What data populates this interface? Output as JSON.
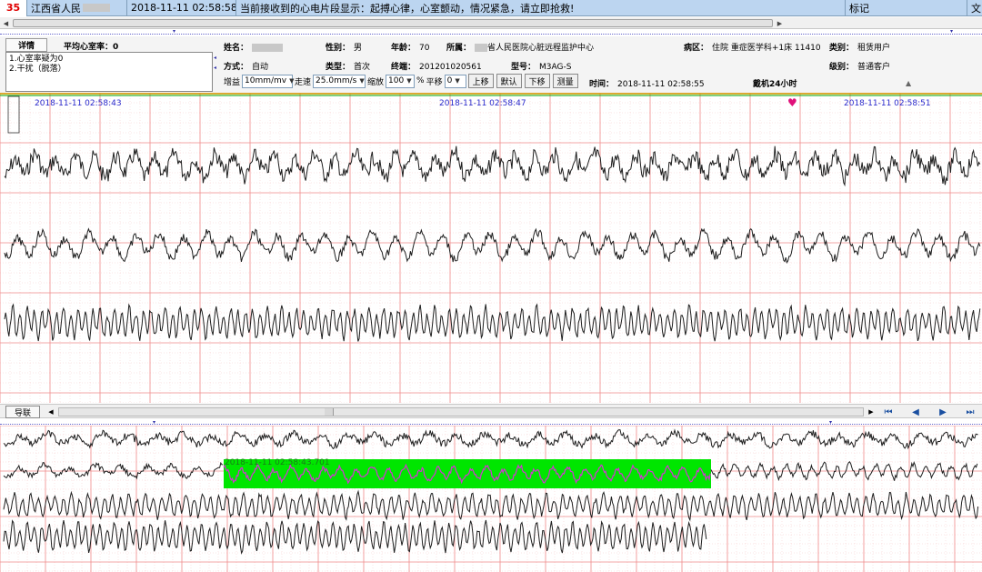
{
  "alarm": {
    "count": "35",
    "hospital": "江西省人民",
    "time": "2018-11-11 02:58:58",
    "message": "当前接收到的心电片段显示：起搏心律，心室颤动，情况紧急，请立即抢救!",
    "mark_label": "标记",
    "extra": "文"
  },
  "detail_tab": "详情",
  "avg_hr": {
    "label": "平均心室率：",
    "value": "0"
  },
  "diagnosis": [
    "1.心室率疑为0",
    "2.干扰（脱落）"
  ],
  "patient": {
    "name_label": "姓名：",
    "gender_label": "性别：",
    "gender": "男",
    "age_label": "年龄：",
    "age": "70",
    "affiliation_label": "所属：",
    "affiliation": "省人民医院心脏远程监护中心",
    "ward_label": "病区：",
    "ward": "住院 重症医学科+1床 11410",
    "category_label": "类别：",
    "category": "租赁用户",
    "mode_label": "方式：",
    "mode": "自动",
    "type_label": "类型：",
    "type": "首次",
    "terminal_label": "终端：",
    "terminal": "201201020561",
    "model_label": "型号：",
    "model": "M3AG-S",
    "level_label": "级别：",
    "level": "普通客户",
    "time_label": "时间：",
    "time": "2018-11-11 02:58:55",
    "wear": "戴机24小时"
  },
  "controls": {
    "gain_label": "增益",
    "gain": "10mm/mv",
    "speed_label": "走速",
    "speed": "25.0mm/s",
    "zoom_label": "缩放",
    "zoom": "100",
    "pct": "%",
    "shift_label": "平移",
    "shift": "0",
    "btn_up": "上移",
    "btn_default": "默认",
    "btn_down": "下移",
    "btn_measure": "测量"
  },
  "timestamps": [
    "2018-11-11 02:58:43",
    "2018-11-11 02:58:47",
    "2018-11-11 02:58:51"
  ],
  "nav": {
    "button": "导联"
  },
  "overview": {
    "selection_label": "2018-11-11 02:58:43.701"
  },
  "colors": {
    "alarm_bg": "#bcd5f0",
    "grid_major": "#f08a8a",
    "grid_minor": "#f7c9c9",
    "trace": "#1e1e1e",
    "selection": "#00e600",
    "selection_trace": "#d633d6",
    "timestamp": "#2a2acc",
    "alarm_count": "#e00000"
  },
  "icons": [
    "first-page-icon",
    "prev-icon",
    "next-icon",
    "last-page-icon",
    "heart-marker-icon"
  ]
}
